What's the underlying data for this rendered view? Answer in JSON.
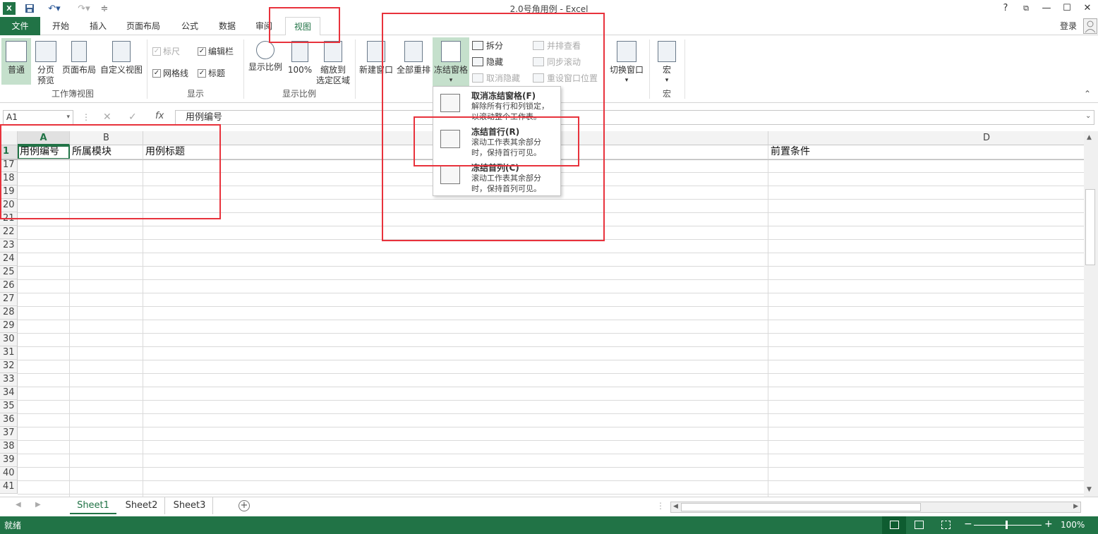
{
  "window": {
    "title": "2.0号角用例 - Excel",
    "help": "?",
    "login": "登录"
  },
  "tabs": [
    "文件",
    "开始",
    "插入",
    "页面布局",
    "公式",
    "数据",
    "审阅",
    "视图"
  ],
  "ribbon": {
    "workbook_views": {
      "label": "工作簿视图",
      "normal": "普通",
      "page_break_1": "分页",
      "page_break_2": "预览",
      "page_layout": "页面布局",
      "custom_views": "自定义视图"
    },
    "show": {
      "label": "显示",
      "ruler": "标尺",
      "formula_bar": "编辑栏",
      "gridlines": "网格线",
      "headings": "标题"
    },
    "zoom": {
      "label": "显示比例",
      "zoom": "显示比例",
      "hundred": "100%",
      "zoom_sel_1": "缩放到",
      "zoom_sel_2": "选定区域"
    },
    "window_group": {
      "new_window": "新建窗口",
      "arrange_all": "全部重排",
      "freeze_panes": "冻结窗格",
      "split": "拆分",
      "hide": "隐藏",
      "unhide": "取消隐藏",
      "side_by_side": "并排查看",
      "sync_scroll": "同步滚动",
      "reset_position": "重设窗口位置",
      "switch_windows": "切换窗口"
    },
    "macros": {
      "label": "宏",
      "macros": "宏"
    }
  },
  "freeze_menu": {
    "items": [
      {
        "title": "取消冻结窗格(F)",
        "desc_1": "解除所有行和列锁定，",
        "desc_2": "以滚动整个工作表。"
      },
      {
        "title": "冻结首行(R)",
        "desc_1": "滚动工作表其余部分",
        "desc_2": "时，保持首行可见。"
      },
      {
        "title": "冻结首列(C)",
        "desc_1": "滚动工作表其余部分",
        "desc_2": "时，保持首列可见。"
      }
    ]
  },
  "formula_bar": {
    "name_box": "A1",
    "fx": "fx",
    "value": "用例编号"
  },
  "grid": {
    "columns": [
      "A",
      "B",
      "D"
    ],
    "rows": [
      "1",
      "17",
      "18",
      "19",
      "20",
      "21",
      "22",
      "23",
      "24",
      "25",
      "26",
      "27",
      "28",
      "29",
      "30",
      "31",
      "32",
      "33",
      "34",
      "35",
      "36",
      "37",
      "38",
      "39",
      "40",
      "41"
    ],
    "row1": {
      "a": "用例编号",
      "b": "所属模块",
      "c": "用例标题",
      "d": "前置条件"
    }
  },
  "sheets": [
    "Sheet1",
    "Sheet2",
    "Sheet3"
  ],
  "status": {
    "ready": "就绪",
    "zoom": "100%"
  },
  "colors": {
    "accent": "#217346",
    "highlight": "#e8323c"
  }
}
